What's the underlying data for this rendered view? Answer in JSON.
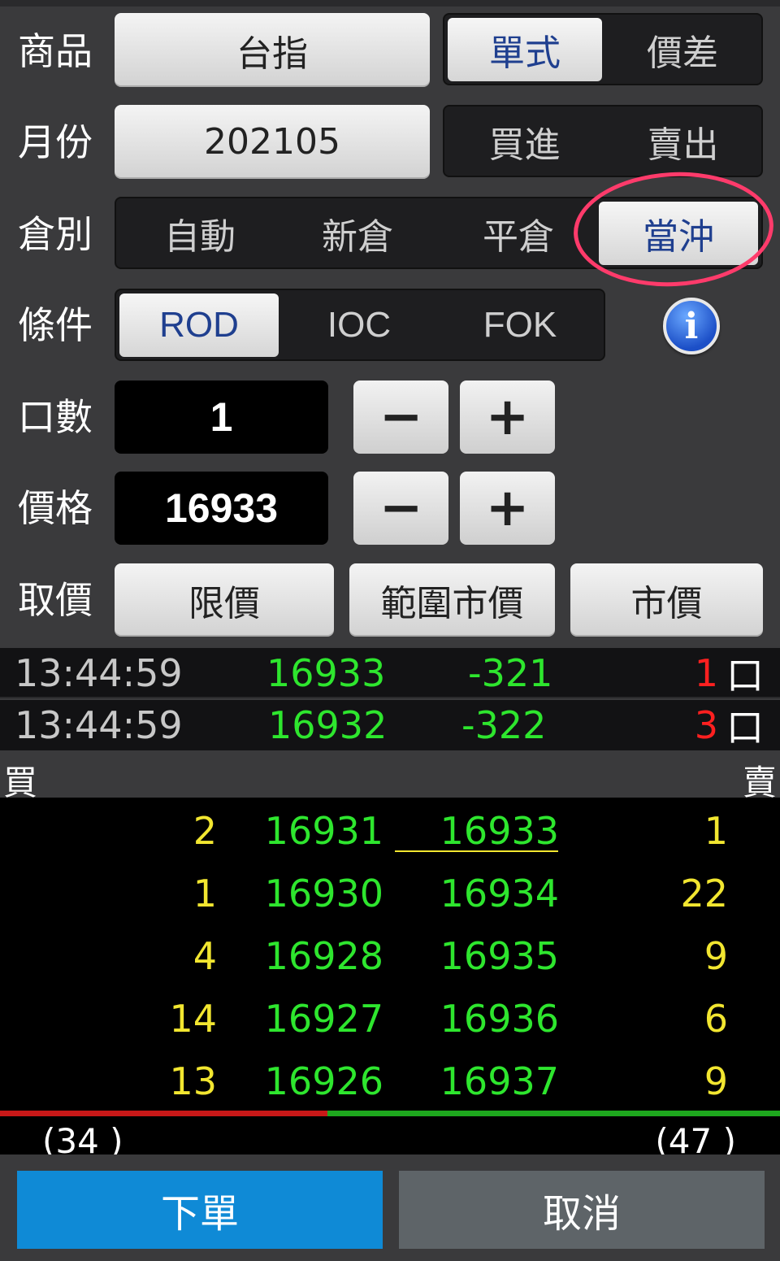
{
  "form": {
    "product": {
      "label": "商品",
      "value": "台指",
      "toggle": [
        "單式",
        "價差"
      ],
      "selected": "單式"
    },
    "month": {
      "label": "月份",
      "value": "202105",
      "toggle": [
        "買進",
        "賣出"
      ]
    },
    "position": {
      "label": "倉別",
      "options": [
        "自動",
        "新倉",
        "平倉",
        "當沖"
      ],
      "selected": "當沖"
    },
    "condition": {
      "label": "條件",
      "options": [
        "ROD",
        "IOC",
        "FOK"
      ],
      "selected": "ROD",
      "info_icon": "info-icon"
    },
    "quantity": {
      "label": "口數",
      "value": "1",
      "minus": "−",
      "plus": "+"
    },
    "price": {
      "label": "價格",
      "value": "16933",
      "minus": "−",
      "plus": "+"
    },
    "price_type": {
      "label": "取價",
      "options": [
        "限價",
        "範圍市價",
        "市價"
      ]
    }
  },
  "ticks": [
    {
      "time": "13:44:59",
      "price": "16933",
      "change": "-321",
      "qty": "1",
      "unit": "口"
    },
    {
      "time": "13:44:59",
      "price": "16932",
      "change": "-322",
      "qty": "3",
      "unit": "口"
    }
  ],
  "book_header": {
    "buy": "買",
    "sell": "賣"
  },
  "order_book": [
    {
      "bid_qty": "2",
      "bid": "16931",
      "ask": "16933",
      "ask_qty": "1"
    },
    {
      "bid_qty": "1",
      "bid": "16930",
      "ask": "16934",
      "ask_qty": "22"
    },
    {
      "bid_qty": "4",
      "bid": "16928",
      "ask": "16935",
      "ask_qty": "9"
    },
    {
      "bid_qty": "14",
      "bid": "16927",
      "ask": "16936",
      "ask_qty": "6"
    },
    {
      "bid_qty": "13",
      "bid": "16926",
      "ask": "16937",
      "ask_qty": "9"
    }
  ],
  "totals": {
    "buy": "(34 )",
    "sell": "(47 )"
  },
  "actions": {
    "submit": "下單",
    "cancel": "取消"
  },
  "colors": {
    "price_green": "#2ee62e",
    "qty_yellow": "#f2e630",
    "tick_red": "#ff2020",
    "submit_blue": "#0f8ad6",
    "selected_text": "#1f3f8f",
    "annotation_ring": "#ff3b6b"
  }
}
